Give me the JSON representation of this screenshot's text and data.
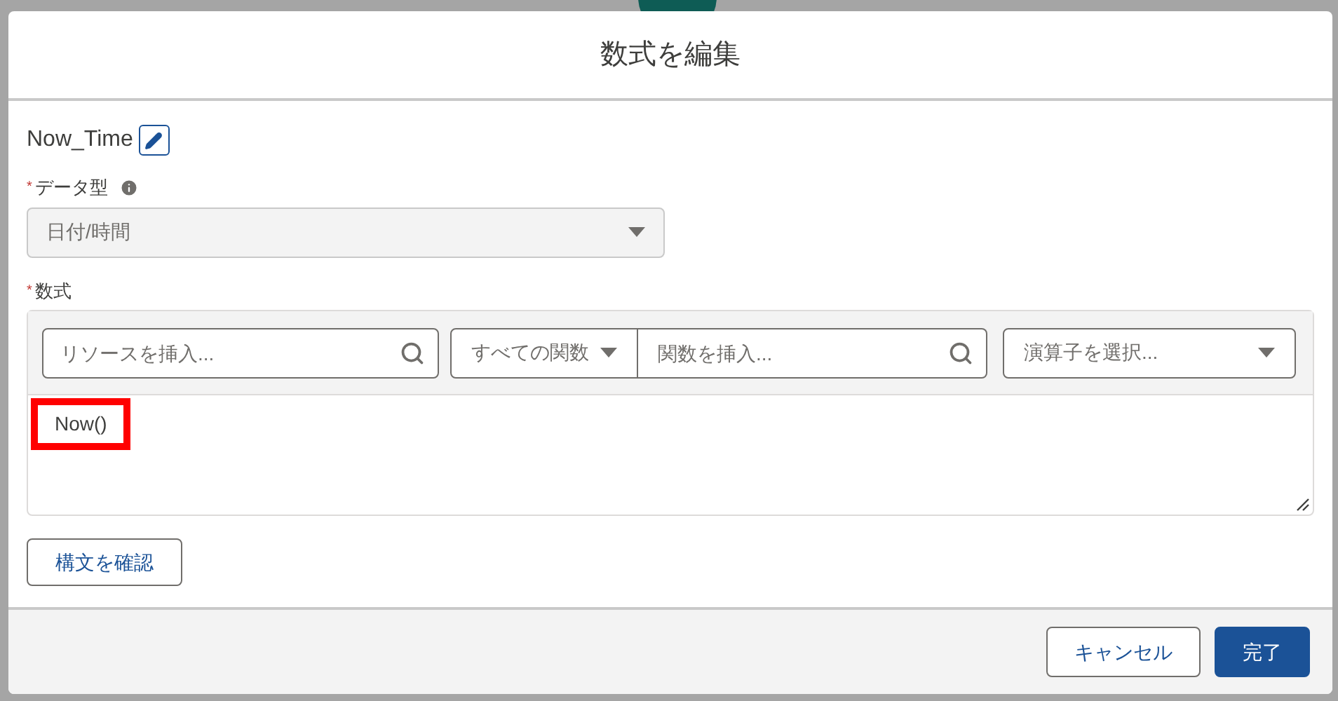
{
  "modal": {
    "title": "数式を編集"
  },
  "resource_name": {
    "value": "Now_Time"
  },
  "data_type": {
    "label": "データ型",
    "required_mark": "*",
    "value": "日付/時間",
    "disabled": true
  },
  "formula": {
    "label": "数式",
    "required_mark": "*",
    "resource_search": {
      "placeholder": "リソースを挿入..."
    },
    "function_category": {
      "value": "すべての関数"
    },
    "function_search": {
      "placeholder": "関数を挿入..."
    },
    "operator_select": {
      "placeholder": "演算子を選択..."
    },
    "value": "Now()",
    "highlighted": true
  },
  "check_syntax_button": "構文を確認",
  "footer": {
    "buttons": [
      {
        "label": "キャンセル",
        "kind": "neutral"
      },
      {
        "label": "完了",
        "kind": "brand"
      }
    ]
  }
}
